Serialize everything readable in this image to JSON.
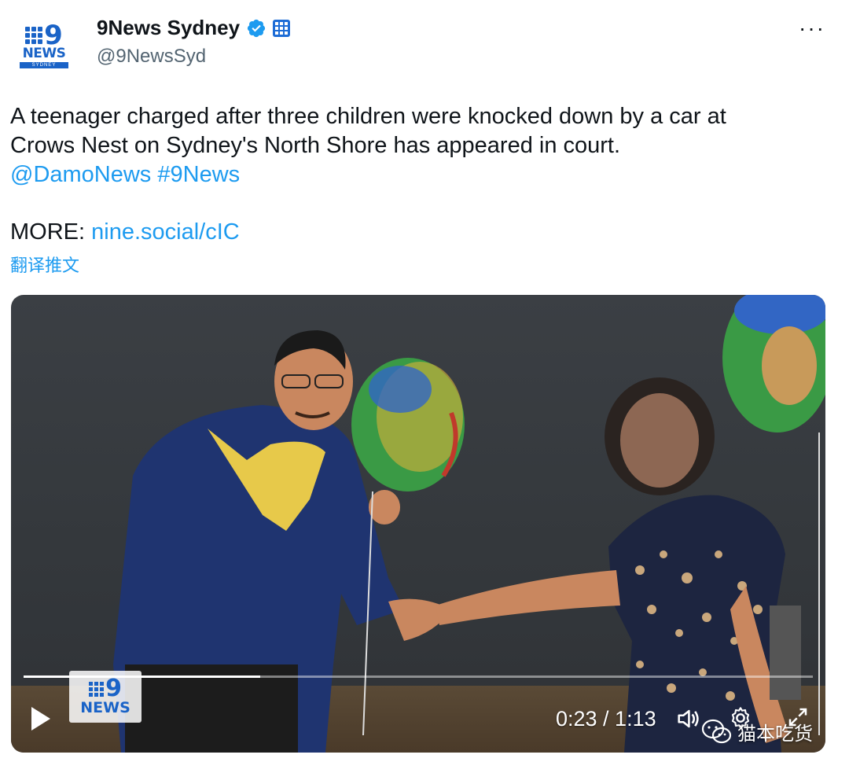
{
  "tweet": {
    "author": {
      "display_name": "9News Sydney",
      "handle": "@9NewsSyd",
      "avatar_logo": {
        "top": "9",
        "bottom": "NEWS",
        "sub": "SYDNEY"
      },
      "verified_icon": "verified-badge-icon",
      "affiliation_icon": "9news-affiliate-icon"
    },
    "more_menu": "···",
    "text": {
      "line1": "A teenager charged after three children were knocked down by a car at",
      "line2": "Crows Nest on Sydney's North Shore has appeared in court.",
      "mention": "@DamoNews",
      "hashtag": "#9News",
      "more_label": "MORE:",
      "more_link": "nine.social/cIC"
    },
    "translate": "翻译推文"
  },
  "video": {
    "watermark": {
      "top": "9",
      "bottom": "NEWS"
    },
    "progress": 0.3,
    "time_label": "0:23 / 1:13",
    "overlay_mark": "猫本吃货"
  },
  "colors": {
    "link": "#1d9bf0",
    "text": "#0f1419",
    "secondary": "#536471",
    "brand": "#1a63c7",
    "verified": "#1d9bf0"
  }
}
